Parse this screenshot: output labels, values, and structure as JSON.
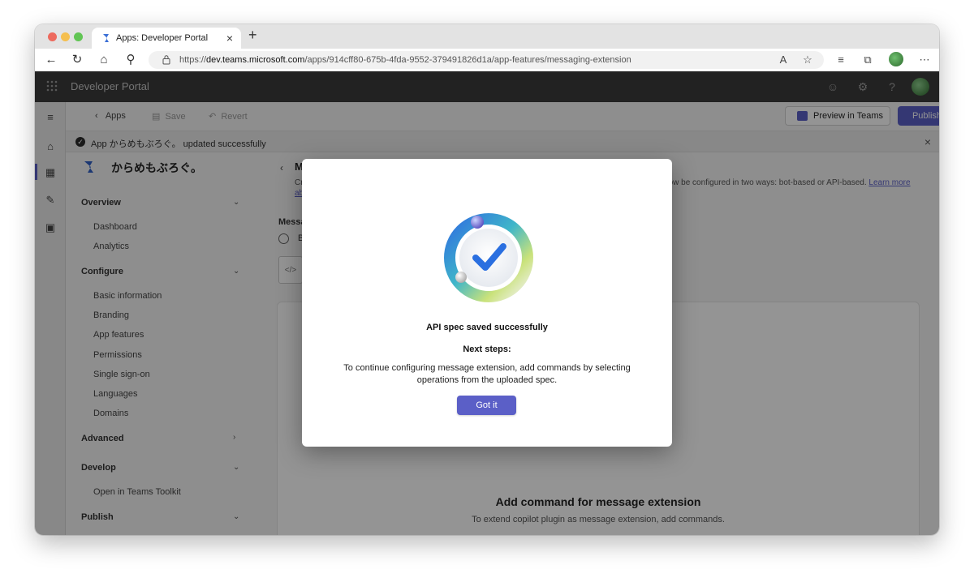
{
  "browser": {
    "tab_title": "Apps: Developer Portal",
    "url_prefix": "https://",
    "url_host": "dev.teams.microsoft.com",
    "url_path": "/apps/914cff80-675b-4fda-9552-379491826d1a/app-features/messaging-extension"
  },
  "header": {
    "app_title": "Developer Portal"
  },
  "commandbar": {
    "back_label": "Apps",
    "save_label": "Save",
    "revert_label": "Revert",
    "preview_label": "Preview in Teams",
    "publish_label": "Publish"
  },
  "notification": {
    "text": "App からめもぶろぐ。 updated successfully"
  },
  "leftnav": {
    "app_name": "からめもぶろぐ。",
    "sections": [
      {
        "label": "Overview",
        "items": [
          "Dashboard",
          "Analytics"
        ]
      },
      {
        "label": "Configure",
        "items": [
          "Basic information",
          "Branding",
          "App features",
          "Permissions",
          "Single sign-on",
          "Languages",
          "Domains"
        ]
      },
      {
        "label": "Advanced",
        "items": []
      },
      {
        "label": "Develop",
        "items": [
          "Open in Teams Toolkit"
        ]
      },
      {
        "label": "Publish",
        "items": []
      }
    ]
  },
  "content": {
    "title_fragment": "M",
    "desc_left": "Cr",
    "desc_right": "can now be configured in two ways: bot-based or API-based.",
    "desc_link": "Learn more",
    "desc_link2": "abo",
    "section_label": "Messag",
    "radio_label": "Bo",
    "file_icon_text": "</>",
    "empty_heading": "Add command for message extension",
    "empty_sub": "To extend copilot plugin as message extension, add commands."
  },
  "dialog": {
    "title": "API spec saved successfully",
    "next_steps": "Next steps:",
    "body": "To continue configuring message extension, add commands by selecting operations from the uploaded spec.",
    "button": "Got it"
  },
  "colors": {
    "accent": "#5b5fc7",
    "header_bg": "#3b3b3b"
  }
}
